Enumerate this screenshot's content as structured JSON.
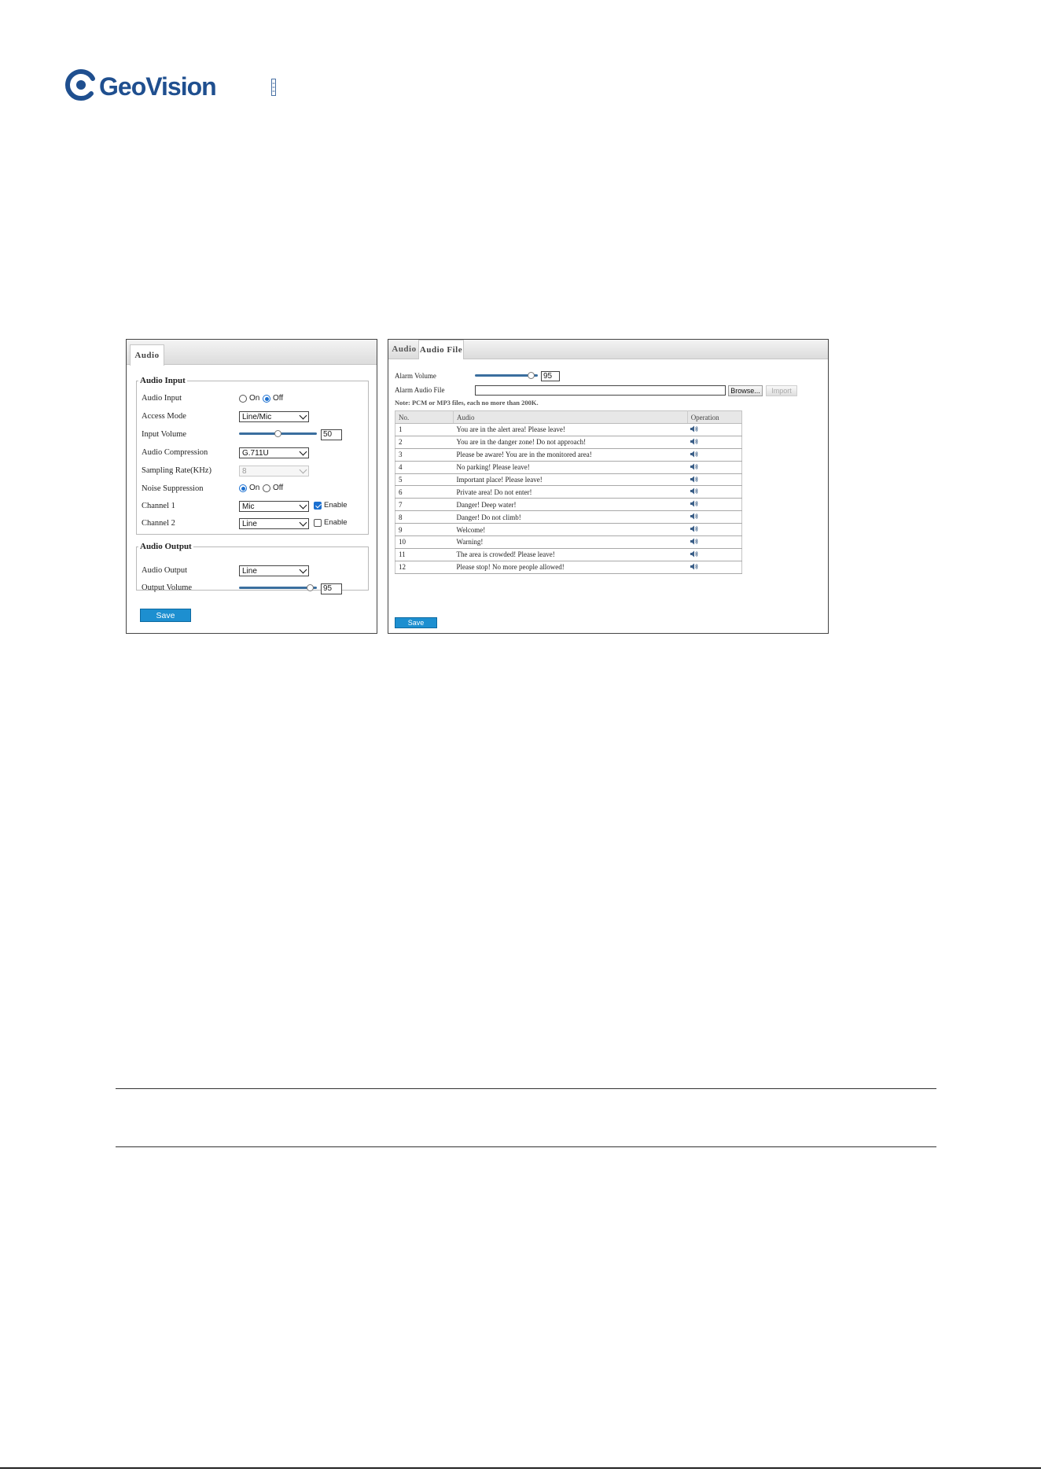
{
  "brand": {
    "name": "GeoVision",
    "accent": "#1f4f8f"
  },
  "panel_left": {
    "tab_label": "Audio",
    "audio_input_group": {
      "legend": "Audio Input",
      "rows": {
        "audio_input": {
          "label": "Audio Input",
          "opt_on": "On",
          "opt_off": "Off",
          "selected": "Off"
        },
        "access_mode": {
          "label": "Access Mode",
          "value": "Line/Mic"
        },
        "input_volume": {
          "label": "Input Volume",
          "value": "50",
          "level": 0.5
        },
        "audio_compression": {
          "label": "Audio Compression",
          "value": "G.711U"
        },
        "sampling_rate": {
          "label": "Sampling Rate(KHz)",
          "value": "8"
        },
        "noise_suppression": {
          "label": "Noise Suppression",
          "opt_on": "On",
          "opt_off": "Off",
          "selected": "On"
        },
        "channel1": {
          "label": "Channel 1",
          "value": "Mic",
          "enable_label": "Enable",
          "enabled": true
        },
        "channel2": {
          "label": "Channel 2",
          "value": "Line",
          "enable_label": "Enable",
          "enabled": false
        }
      }
    },
    "audio_output_group": {
      "legend": "Audio Output",
      "rows": {
        "audio_output": {
          "label": "Audio Output",
          "value": "Line"
        },
        "output_volume": {
          "label": "Output Volume",
          "value": "95",
          "level": 0.95
        }
      }
    },
    "save_label": "Save"
  },
  "panel_right": {
    "tabs": [
      "Audio",
      "Audio File"
    ],
    "active_tab": "Audio File",
    "alarm_volume": {
      "label": "Alarm Volume",
      "value": "95",
      "level": 0.95
    },
    "alarm_audio_file": {
      "label": "Alarm Audio File",
      "browse_label": "Browse...",
      "import_label": "Import"
    },
    "note": "Note: PCM or MP3 files, each no more than 200K.",
    "table": {
      "headers": [
        "No.",
        "Audio",
        "Operation"
      ],
      "rows": [
        {
          "no": "1",
          "audio": "You are in the alert area! Please leave!"
        },
        {
          "no": "2",
          "audio": "You are in the danger zone! Do not approach!"
        },
        {
          "no": "3",
          "audio": "Please be aware! You are in the monitored area!"
        },
        {
          "no": "4",
          "audio": "No parking! Please leave!"
        },
        {
          "no": "5",
          "audio": "Important place! Please leave!"
        },
        {
          "no": "6",
          "audio": "Private area! Do not enter!"
        },
        {
          "no": "7",
          "audio": "Danger! Deep water!"
        },
        {
          "no": "8",
          "audio": "Danger! Do not climb!"
        },
        {
          "no": "9",
          "audio": "Welcome!"
        },
        {
          "no": "10",
          "audio": "Warning!"
        },
        {
          "no": "11",
          "audio": "The area is crowded! Please leave!"
        },
        {
          "no": "12",
          "audio": "Please stop! No more people allowed!"
        }
      ]
    },
    "save_label": "Save"
  },
  "icons": {
    "operation": "speaker-icon",
    "logo": "geovision-logo-icon"
  },
  "colors": {
    "save_button": "#1d8fd0",
    "radio_checked": "#1a6fd0",
    "slider_track": "#3a6e9e"
  }
}
